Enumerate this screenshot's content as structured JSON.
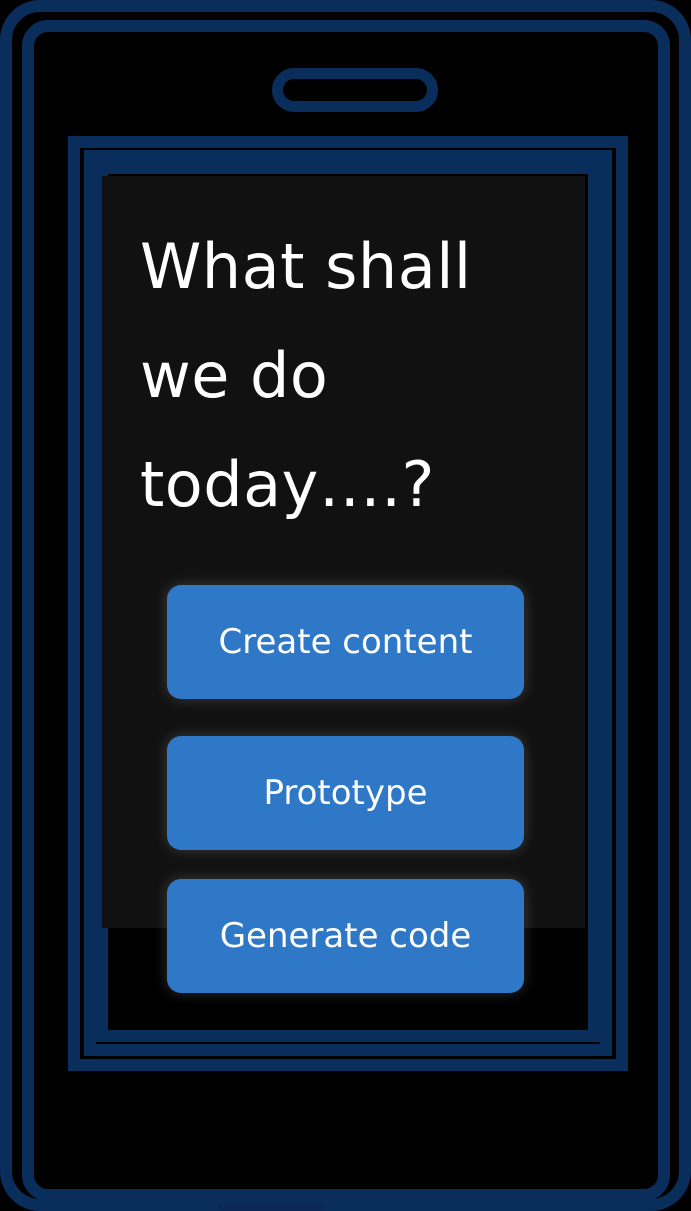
{
  "colors": {
    "frame": "#0a2e5c",
    "button": "#2e78c7",
    "screen_background": "#111111",
    "text": "#ffffff"
  },
  "icons": {
    "speaker": "speaker-slot-icon"
  },
  "screen": {
    "headline_lines": [
      "What shall",
      "we do",
      "today….?"
    ]
  },
  "actions": {
    "create_content_label": "Create content",
    "prototype_label": "Prototype",
    "generate_code_label": "Generate code"
  }
}
